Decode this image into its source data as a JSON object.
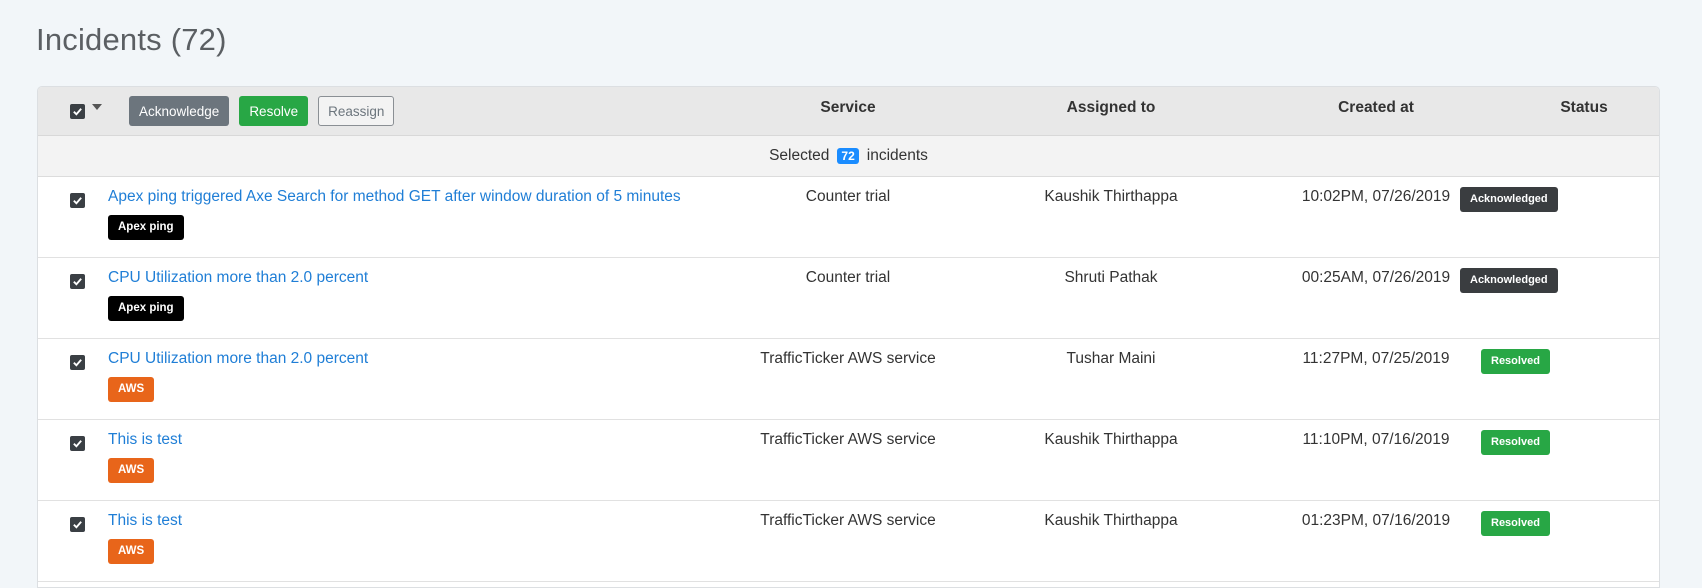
{
  "page": {
    "title": "Incidents (72)"
  },
  "toolbar": {
    "acknowledge_label": "Acknowledge",
    "resolve_label": "Resolve",
    "reassign_label": "Reassign"
  },
  "table": {
    "columns": {
      "service": "Service",
      "assigned_to": "Assigned to",
      "created_at": "Created at",
      "status": "Status"
    },
    "selection": {
      "prefix": "Selected",
      "count": "72",
      "suffix": "incidents"
    },
    "rows": [
      {
        "title": "Apex ping triggered Axe Search for method GET after window duration of 5 minutes",
        "tag": "Apex ping",
        "service": "Counter trial",
        "assigned_to": "Kaushik Thirthappa",
        "created_at": "10:02PM, 07/26/2019",
        "status": "Acknowledged",
        "checked": true
      },
      {
        "title": "CPU Utilization more than 2.0 percent",
        "tag": "Apex ping",
        "service": "Counter trial",
        "assigned_to": "Shruti Pathak",
        "created_at": "00:25AM, 07/26/2019",
        "status": "Acknowledged",
        "checked": true
      },
      {
        "title": "CPU Utilization more than 2.0 percent",
        "tag": "AWS",
        "service": "TrafficTicker AWS service",
        "assigned_to": "Tushar Maini",
        "created_at": "11:27PM, 07/25/2019",
        "status": "Resolved",
        "checked": true
      },
      {
        "title": "This is test",
        "tag": "AWS",
        "service": "TrafficTicker AWS service",
        "assigned_to": "Kaushik Thirthappa",
        "created_at": "11:10PM, 07/16/2019",
        "status": "Resolved",
        "checked": true
      },
      {
        "title": "This is test",
        "tag": "AWS",
        "service": "TrafficTicker AWS service",
        "assigned_to": "Kaushik Thirthappa",
        "created_at": "01:23PM, 07/16/2019",
        "status": "Resolved",
        "checked": true
      }
    ]
  },
  "colors": {
    "link": "#1f7ed6",
    "tag_apex_ping": "#000000",
    "tag_aws": "#e8651a",
    "status_acknowledged": "#3a3d40",
    "status_resolved": "#28a745",
    "count_badge": "#1a8cff"
  },
  "icons": {
    "checkbox": "checkbox-checked-icon",
    "dropdown": "chevron-down-icon"
  }
}
